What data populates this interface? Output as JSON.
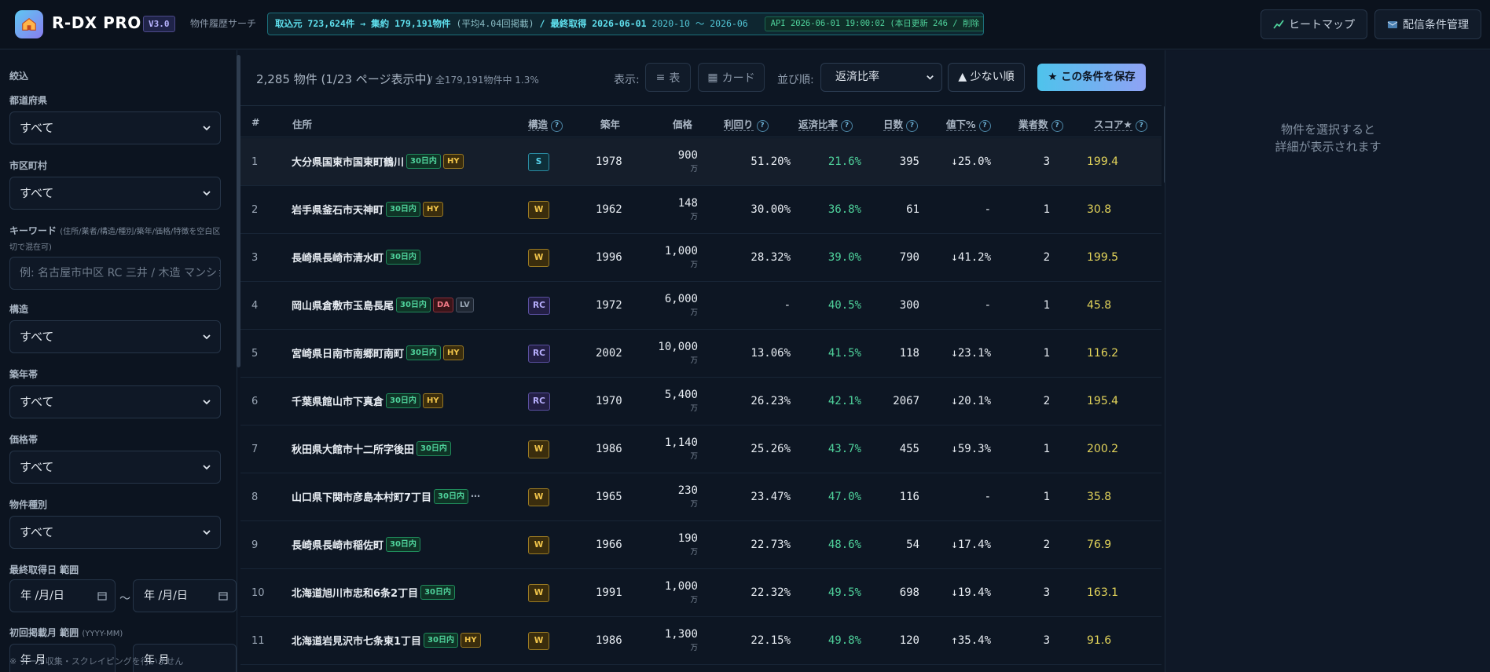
{
  "header": {
    "brand": "R-DX PRO",
    "version": "V3.0",
    "subtitle": "物件履歴サーチ",
    "stats_main": "取込元 723,624件 → 集約 179,191物件",
    "stats_avg": "(平均4.04回掲載)",
    "stats_last_label": "/ 最終取得 2026-06-01",
    "stats_range": "2020-10 〜 2026-06",
    "api_badge": "API 2026-06-01 19:00:02 (本日更新 246 / 削除 0)",
    "heatmap_button": "ヒートマップ",
    "delivery_button": "配信条件管理"
  },
  "sidebar": {
    "title": "絞込",
    "prefecture_label": "都道府県",
    "prefecture_value": "すべて",
    "city_label": "市区町村",
    "city_value": "すべて",
    "keyword_label": "キーワード",
    "keyword_hint": "(住所/業者/構造/種別/築年/価格/特徴を空白区切で混在可)",
    "keyword_placeholder": "例: 名古屋市中区 RC 三井 / 木造 マンション",
    "structure_label": "構造",
    "structure_value": "すべて",
    "built_label": "築年帯",
    "built_value": "すべて",
    "price_label": "価格帯",
    "price_value": "すべて",
    "type_label": "物件種別",
    "type_value": "すべて",
    "lastdate_label": "最終取得日 範囲",
    "date_from": "年 /月/日",
    "date_to": "年 /月/日",
    "tilde": "〜",
    "firstmonth_label": "初回掲載月 範囲",
    "firstmonth_hint": "(YYYY-MM)",
    "month_from": "年 月",
    "month_to": "年 月",
    "footnote": "※ データ収集・スクレイピングを行いません"
  },
  "toolbar": {
    "count": "2,285 物件 (1/23 ページ表示中)",
    "count_total": "/ 全179,191物件中 1.3%",
    "view_label": "表示:",
    "view_table": "表",
    "view_card": "カード",
    "sort_label": "並び順:",
    "sort_value": "返済比率",
    "asc_label": "▲ 少ない順",
    "save_label": "★ この条件を保存"
  },
  "table": {
    "headers": {
      "num": "#",
      "addr": "住所",
      "struct": "構造",
      "built": "築年",
      "price": "価格",
      "yield": "利回り",
      "ratio": "返済比率",
      "days": "日数",
      "drop": "値下%",
      "agents": "業者数",
      "score": "スコア★"
    },
    "help": "?",
    "price_unit": "万",
    "rows": [
      {
        "num": "1",
        "addr": "大分県国東市国東町鶴川",
        "tags": [
          "30日内",
          "HY"
        ],
        "struct": "S",
        "built": "1978",
        "price": "900",
        "yield": "51.20%",
        "ratio": "21.6%",
        "days": "395",
        "drop": "↓25.0%",
        "agents": "3",
        "score": "199.4"
      },
      {
        "num": "2",
        "addr": "岩手県釜石市天神町",
        "tags": [
          "30日内",
          "HY"
        ],
        "struct": "W",
        "built": "1962",
        "price": "148",
        "yield": "30.00%",
        "ratio": "36.8%",
        "days": "61",
        "drop": "-",
        "agents": "1",
        "score": "30.8"
      },
      {
        "num": "3",
        "addr": "長崎県長崎市清水町",
        "tags": [
          "30日内"
        ],
        "struct": "W",
        "built": "1996",
        "price": "1,000",
        "yield": "28.32%",
        "ratio": "39.0%",
        "days": "790",
        "drop": "↓41.2%",
        "agents": "2",
        "score": "199.5"
      },
      {
        "num": "4",
        "addr": "岡山県倉敷市玉島長尾",
        "tags": [
          "30日内",
          "DA",
          "LV"
        ],
        "struct": "RC",
        "built": "1972",
        "price": "6,000",
        "yield": "-",
        "ratio": "40.5%",
        "days": "300",
        "drop": "-",
        "agents": "1",
        "score": "45.8"
      },
      {
        "num": "5",
        "addr": "宮崎県日南市南郷町南町",
        "tags": [
          "30日内",
          "HY"
        ],
        "struct": "RC",
        "built": "2002",
        "price": "10,000",
        "yield": "13.06%",
        "ratio": "41.5%",
        "days": "118",
        "drop": "↓23.1%",
        "agents": "1",
        "score": "116.2"
      },
      {
        "num": "6",
        "addr": "千葉県館山市下真倉",
        "tags": [
          "30日内",
          "HY"
        ],
        "struct": "RC",
        "built": "1970",
        "price": "5,400",
        "yield": "26.23%",
        "ratio": "42.1%",
        "days": "2067",
        "drop": "↓20.1%",
        "agents": "2",
        "score": "195.4"
      },
      {
        "num": "7",
        "addr": "秋田県大館市十二所字後田",
        "tags": [
          "30日内"
        ],
        "struct": "W",
        "built": "1986",
        "price": "1,140",
        "yield": "25.26%",
        "ratio": "43.7%",
        "days": "455",
        "drop": "↓59.3%",
        "agents": "1",
        "score": "200.2"
      },
      {
        "num": "8",
        "addr": "山口県下関市彦島本村町7丁目",
        "tags": [
          "30日内",
          "…"
        ],
        "struct": "W",
        "built": "1965",
        "price": "230",
        "yield": "23.47%",
        "ratio": "47.0%",
        "days": "116",
        "drop": "-",
        "agents": "1",
        "score": "35.8"
      },
      {
        "num": "9",
        "addr": "長崎県長崎市稲佐町",
        "tags": [
          "30日内"
        ],
        "struct": "W",
        "built": "1966",
        "price": "190",
        "yield": "22.73%",
        "ratio": "48.6%",
        "days": "54",
        "drop": "↓17.4%",
        "agents": "2",
        "score": "76.9"
      },
      {
        "num": "10",
        "addr": "北海道旭川市忠和6条2丁目",
        "tags": [
          "30日内"
        ],
        "struct": "W",
        "built": "1991",
        "price": "1,000",
        "yield": "22.32%",
        "ratio": "49.5%",
        "days": "698",
        "drop": "↓19.4%",
        "agents": "3",
        "score": "163.1"
      },
      {
        "num": "11",
        "addr": "北海道岩見沢市七条東1丁目",
        "tags": [
          "30日内",
          "HY"
        ],
        "struct": "W",
        "built": "1986",
        "price": "1,300",
        "yield": "22.15%",
        "ratio": "49.8%",
        "days": "120",
        "drop": "↑35.4%",
        "agents": "3",
        "score": "91.6"
      }
    ]
  },
  "detail": {
    "line1": "物件を選択すると",
    "line2": "詳細が表示されます"
  }
}
